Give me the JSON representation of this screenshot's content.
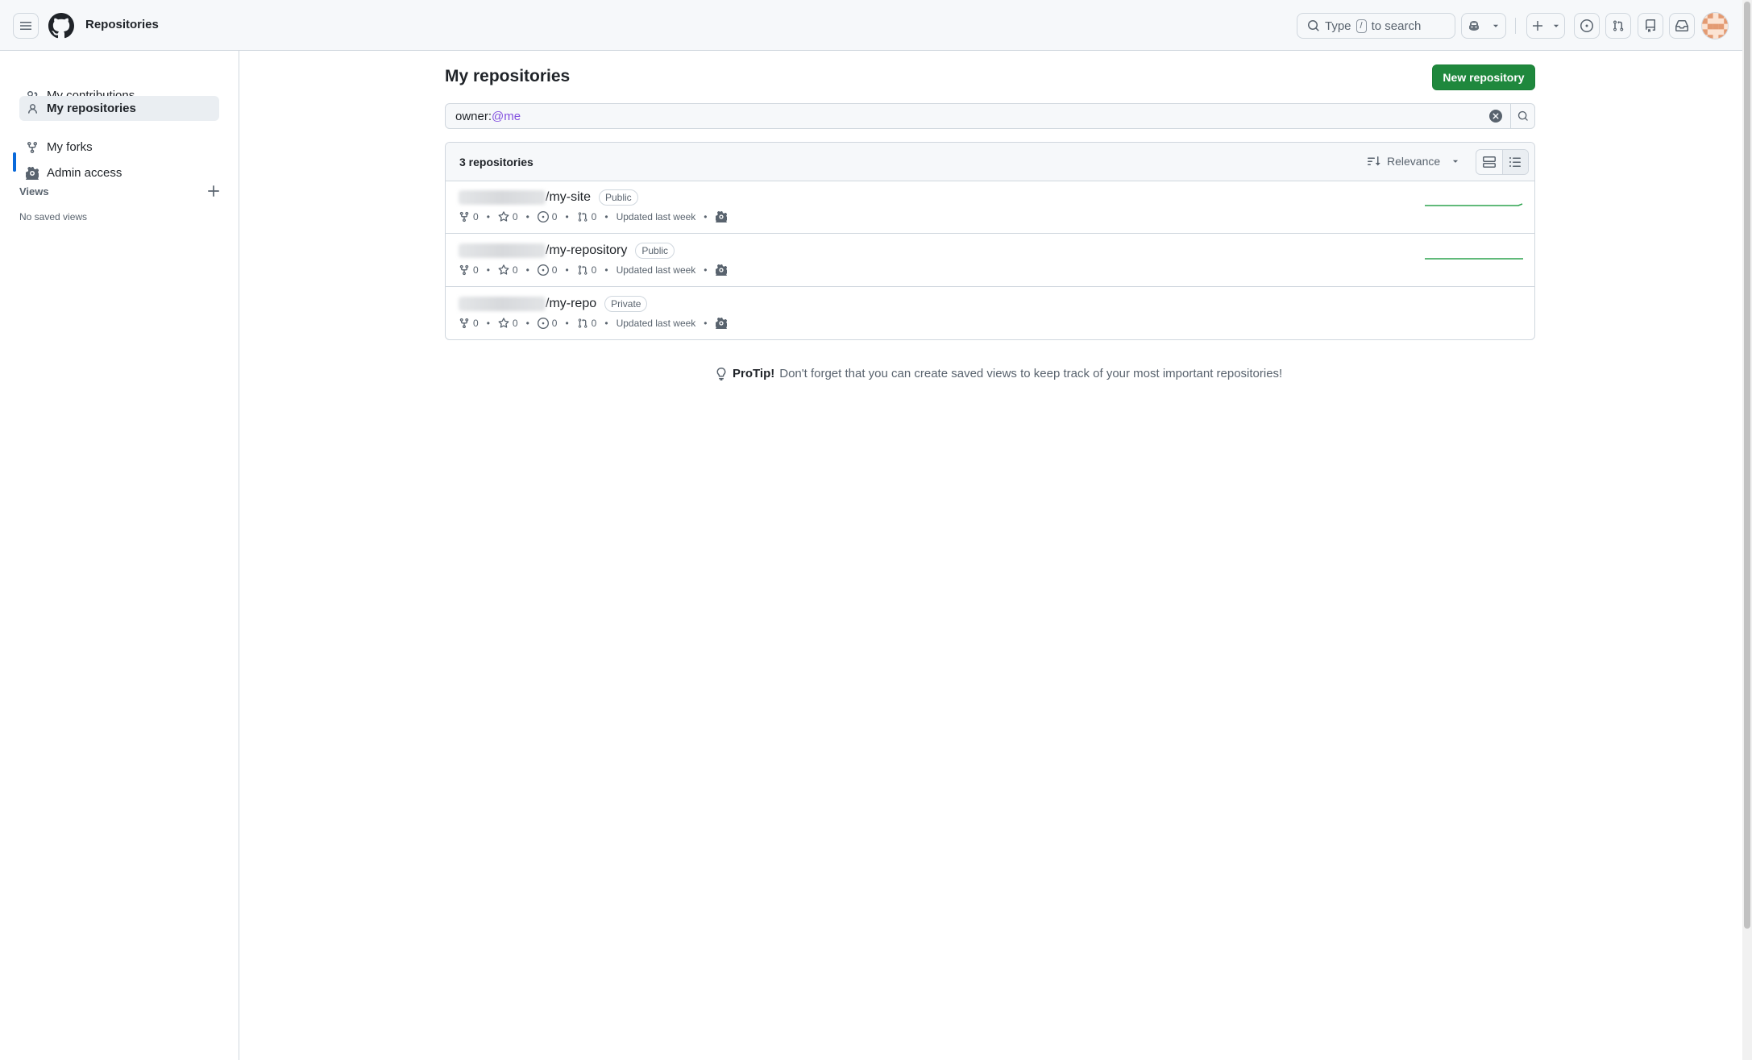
{
  "header": {
    "title": "Repositories",
    "search_prefix": "Type",
    "search_key": "/",
    "search_suffix": "to search"
  },
  "sidebar": {
    "items": [
      {
        "label": "My contributions",
        "icon": "people-icon"
      },
      {
        "label": "My repositories",
        "icon": "person-icon",
        "active": true
      },
      {
        "label": "My forks",
        "icon": "fork-icon"
      },
      {
        "label": "Admin access",
        "icon": "gear-icon"
      }
    ],
    "views_label": "Views",
    "no_views": "No saved views"
  },
  "main": {
    "title": "My repositories",
    "new_button": "New repository",
    "filter_prefix": "owner:",
    "filter_qualifier": "@me",
    "count_label": "3 repositories",
    "sort_label": "Relevance",
    "repos": [
      {
        "name": "/my-site",
        "visibility": "Public",
        "forks": "0",
        "stars": "0",
        "issues": "0",
        "prs": "0",
        "updated": "Updated last week",
        "has_activity": true
      },
      {
        "name": "/my-repository",
        "visibility": "Public",
        "forks": "0",
        "stars": "0",
        "issues": "0",
        "prs": "0",
        "updated": "Updated last week",
        "has_activity": true
      },
      {
        "name": "/my-repo",
        "visibility": "Private",
        "forks": "0",
        "stars": "0",
        "issues": "0",
        "prs": "0",
        "updated": "Updated last week",
        "has_activity": false
      }
    ],
    "protip_bold": "ProTip!",
    "protip_text": "Don't forget that you can create saved views to keep track of your most important repositories!"
  },
  "colors": {
    "accent": "#0969da",
    "primary_button": "#1f883d",
    "qualifier": "#8250df",
    "sparkline": "#2da44e"
  }
}
